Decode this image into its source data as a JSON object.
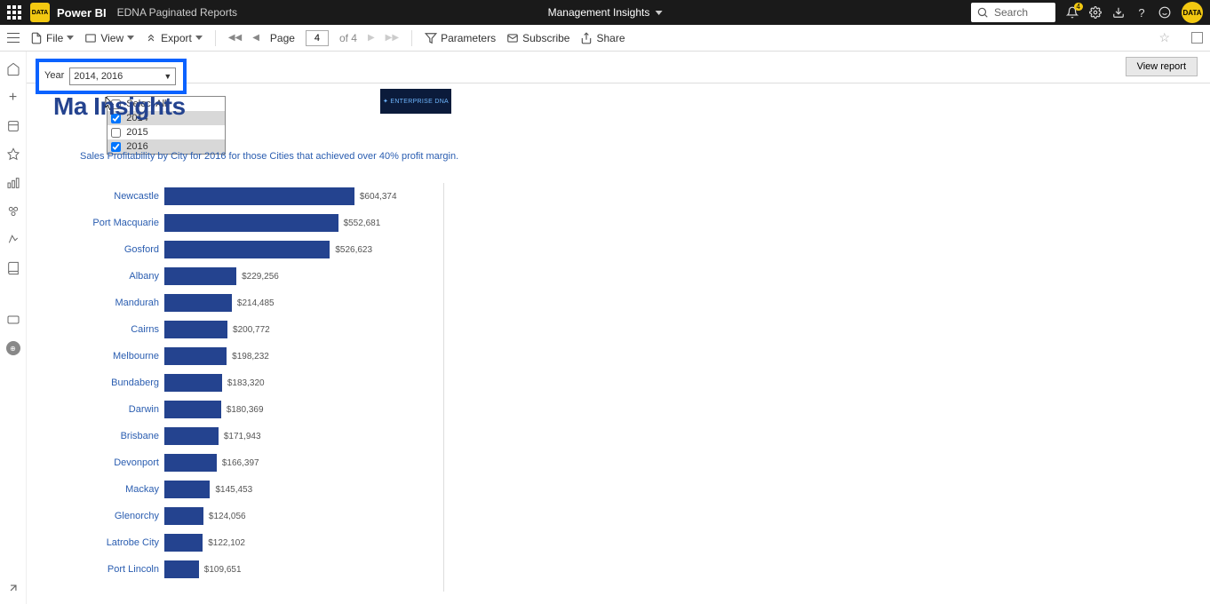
{
  "header": {
    "logo_text": "DATA",
    "app_name": "Power BI",
    "workspace": "EDNA Paginated Reports",
    "center_title": "Management Insights",
    "search_placeholder": "Search",
    "notif_count": "4"
  },
  "toolbar": {
    "file": "File",
    "view": "View",
    "export": "Export",
    "page_label": "Page",
    "page_current": "4",
    "page_of": "of 4",
    "parameters": "Parameters",
    "subscribe": "Subscribe",
    "share": "Share"
  },
  "params": {
    "year_label": "Year",
    "year_value": "2014,  2016",
    "select_all": "Select All",
    "options": [
      "2014",
      "2015",
      "2016"
    ],
    "checked": [
      true,
      false,
      true
    ],
    "view_report": "View report"
  },
  "report": {
    "title_visible": "Ma                        Insights",
    "logo_text": "✦ ENTERPRISE DNA",
    "subtitle": "Sales Profitability by City for 2016 for those Cities that achieved over 40% profit margin."
  },
  "chart_data": {
    "type": "bar",
    "title": "Sales Profitability by City",
    "xlabel": "",
    "ylabel": "",
    "categories": [
      "Newcastle",
      "Port Macquarie",
      "Gosford",
      "Albany",
      "Mandurah",
      "Cairns",
      "Melbourne",
      "Bundaberg",
      "Darwin",
      "Brisbane",
      "Devonport",
      "Mackay",
      "Glenorchy",
      "Latrobe City",
      "Port Lincoln"
    ],
    "values": [
      604374,
      552681,
      526623,
      229256,
      214485,
      200772,
      198232,
      183320,
      180369,
      171943,
      166397,
      145453,
      124056,
      122102,
      109651
    ],
    "value_labels": [
      "$604,374",
      "$552,681",
      "$526,623",
      "$229,256",
      "$214,485",
      "$200,772",
      "$198,232",
      "$183,320",
      "$180,369",
      "$171,943",
      "$166,397",
      "$145,453",
      "$124,056",
      "$122,102",
      "$109,651"
    ],
    "ylim": [
      0,
      650000
    ]
  }
}
